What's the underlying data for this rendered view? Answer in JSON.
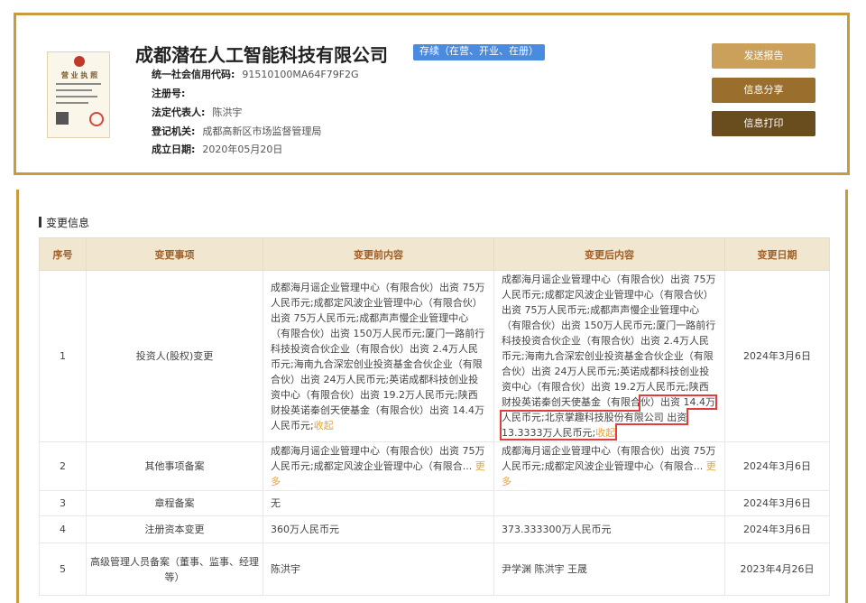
{
  "company": {
    "license_title": "营 业 执 照",
    "name": "成都潜在人工智能科技有限公司",
    "status": "存续（在营、开业、在册）",
    "credit_code_label": "统一社会信用代码:",
    "credit_code": "91510100MA64F79F2G",
    "reg_no_label": "注册号:",
    "reg_no": "",
    "legal_rep_label": "法定代表人:",
    "legal_rep": "陈洪宇",
    "authority_label": "登记机关:",
    "authority": "成都高新区市场监督管理局",
    "founded_label": "成立日期:",
    "founded": "2020年05月20日"
  },
  "actions": {
    "send_report": "发送报告",
    "share": "信息分享",
    "print": "信息打印"
  },
  "changes": {
    "title": "变更信息",
    "headers": [
      "序号",
      "变更事项",
      "变更前内容",
      "变更后内容",
      "变更日期"
    ],
    "rows": [
      {
        "no": "1",
        "item": "投资人(股权)变更",
        "before": "成都海月谣企业管理中心（有限合伙）出资 75万人民币元;成都定风波企业管理中心（有限合伙）出资 75万人民币元;成都声声慢企业管理中心（有限合伙）出资 150万人民币元;厦门一路前行科技投资合伙企业（有限合伙）出资 2.4万人民币元;海南九合深宏创业投资基金合伙企业（有限合伙）出资 24万人民币元;英诺成都科技创业投资中心（有限合伙）出资 19.2万人民币元;陕西财投英诺秦创天使基金（有限合伙）出资 14.4万人民币元;",
        "before_link": "收起",
        "after_main": "成都海月谣企业管理中心（有限合伙）出资 75万人民币元;成都定风波企业管理中心（有限合伙）出资 75万人民币元;成都声声慢企业管理中心（有限合伙）出资 150万人民币元;厦门一路前行科技投资合伙企业（有限合伙）出资 2.4万人民币元;海南九合深宏创业投资基金合伙企业（有限合伙）出资 24万人民币元;英诺成都科技创业投资中心（有限合伙）出资 19.2万人民币元;陕西财投英诺秦创天使基金（有限合",
        "after_highlight": "伙）出资 14.4万人民币元;北京掌趣科技股份有限公司 出资 13.3333万人民币元;",
        "after_link": "收起",
        "date": "2024年3月6日"
      },
      {
        "no": "2",
        "item": "其他事项备案",
        "before": "成都海月谣企业管理中心（有限合伙）出资 75万人民币元;成都定风波企业管理中心（有限合...",
        "before_link": "更多",
        "after": "成都海月谣企业管理中心（有限合伙）出资 75万人民币元;成都定风波企业管理中心（有限合...",
        "after_link": "更多",
        "date": "2024年3月6日"
      },
      {
        "no": "3",
        "item": "章程备案",
        "before": "无",
        "after": "",
        "date": "2024年3月6日"
      },
      {
        "no": "4",
        "item": "注册资本变更",
        "before": "360万人民币元",
        "after": "373.333300万人民币元",
        "date": "2024年3月6日"
      },
      {
        "no": "5",
        "item": "高级管理人员备案（董事、监事、经理等）",
        "before": "陈洪宇",
        "after": "尹学渊 陈洪宇 王晟",
        "date": "2023年4月26日"
      }
    ]
  },
  "colors": {
    "frame": "#c99a3e",
    "badge": "#4a8be0",
    "header_bg": "#f1e6cf",
    "header_text": "#a0602a",
    "link": "#e8a33a",
    "highlight_border": "#e23d3d"
  }
}
